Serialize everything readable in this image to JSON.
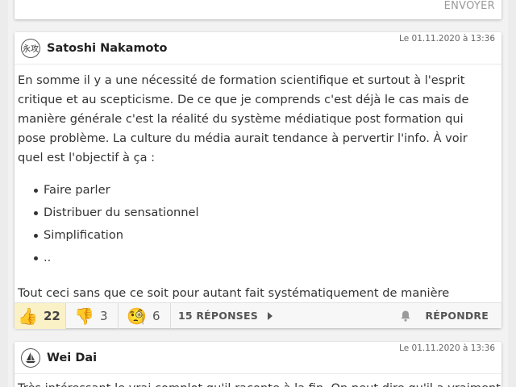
{
  "top_card": {
    "send_label": "ENVOYER"
  },
  "comment1": {
    "author": "Satoshi Nakamoto",
    "avatar_text": "永攻",
    "date": "Le 01.11.2020 à 13:36",
    "paragraph1": "En somme il y a une nécessité de formation scientifique et surtout à l'esprit critique et au scepticisme. De ce que je comprends c'est déjà le cas mais de manière générale c'est la réalité du système médiatique post formation qui pose problème. La culture du média aurait tendance à pervertir l'info. À voir quel est l'objectif à ça :",
    "list_items": [
      "Faire parler",
      "Distribuer du sensationnel",
      "Simplification",
      ".."
    ],
    "paragraph2": "Tout ceci sans que ce soit pour autant fait systématiquement de manière malhonnête.",
    "reactions": {
      "like_icon": "thumbs-up-icon",
      "like_emoji": "👍",
      "like_count": "22",
      "dislike_icon": "thumbs-down-icon",
      "dislike_emoji": "👎",
      "dislike_count": "3",
      "wow_icon": "monocle-face-icon",
      "wow_emoji": "🧐",
      "wow_count": "6"
    },
    "replies_label": "15 RÉPONSES",
    "reply_label": "RÉPONDRE"
  },
  "comment2": {
    "author": "Wei Dai",
    "date": "Le 01.11.2020 à 13:36",
    "text": "Très intéressant le vrai complot qu'il raconte à la fin. On peut dire qu'il a vraiment"
  },
  "colors": {
    "like_bg": "#fbf1c6",
    "card_bg": "#ffffff",
    "page_bg": "#ececec"
  }
}
